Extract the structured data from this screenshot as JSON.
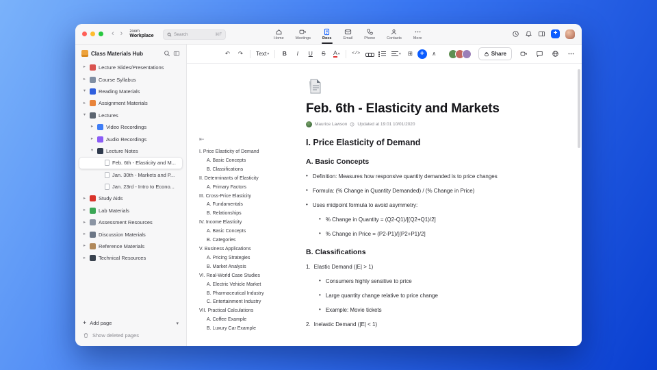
{
  "app": {
    "brand_top": "zoom",
    "brand_bottom": "Workplace",
    "accent_color": "#0b5cff",
    "search": {
      "placeholder": "Search",
      "shortcut": "⌘F"
    },
    "nav": [
      {
        "id": "home",
        "label": "Home",
        "active": false
      },
      {
        "id": "meetings",
        "label": "Meetings",
        "active": false
      },
      {
        "id": "docs",
        "label": "Docs",
        "active": true
      },
      {
        "id": "email",
        "label": "Email",
        "active": false
      },
      {
        "id": "phone",
        "label": "Phone",
        "active": false
      },
      {
        "id": "contacts",
        "label": "Contacts",
        "active": false
      },
      {
        "id": "more",
        "label": "More",
        "active": false
      }
    ]
  },
  "sidebar": {
    "title": "Class Materials Hub",
    "add_page_label": "Add page",
    "show_deleted_label": "Show deleted pages",
    "items": [
      {
        "label": "Lecture Slides/Presentations",
        "depth": 0,
        "chevron": "right",
        "icon": "presentation",
        "color": "#d9534f"
      },
      {
        "label": "Course Syllabus",
        "depth": 0,
        "chevron": "right",
        "icon": "syllabus-document",
        "color": "#7f8ea3"
      },
      {
        "label": "Reading Materials",
        "depth": 0,
        "chevron": "down",
        "icon": "book",
        "color": "#2f5fde"
      },
      {
        "label": "Assignment Materials",
        "depth": 0,
        "chevron": "right",
        "icon": "assignment-pencil",
        "color": "#e8833a"
      },
      {
        "label": "Lectures",
        "depth": 0,
        "chevron": "down",
        "icon": "graduation-cap",
        "color": "#5b6470"
      },
      {
        "label": "Video Recordings",
        "depth": 1,
        "chevron": "right",
        "icon": "video-camera",
        "color": "#3f7df6"
      },
      {
        "label": "Audio Recordings",
        "depth": 1,
        "chevron": "right",
        "icon": "audio-note",
        "color": "#8b5cf6"
      },
      {
        "label": "Lecture Notes",
        "depth": 1,
        "chevron": "down",
        "icon": "notebook",
        "color": "#2f3a4d"
      },
      {
        "label": "Feb. 6th - Elasticity and M...",
        "depth": 2,
        "icon": "page",
        "selected": true
      },
      {
        "label": "Jan. 30th - Markets and P...",
        "depth": 2,
        "icon": "page"
      },
      {
        "label": "Jan. 23rd - Intro to Econo...",
        "depth": 2,
        "icon": "page"
      },
      {
        "label": "Study Aids",
        "depth": 0,
        "chevron": "right",
        "icon": "apple",
        "color": "#d9342b"
      },
      {
        "label": "Lab Materials",
        "depth": 0,
        "chevron": "right",
        "icon": "lab-flask",
        "color": "#3aa655"
      },
      {
        "label": "Assessment Resources",
        "depth": 0,
        "chevron": "right",
        "icon": "assessment-clipboard",
        "color": "#8a94a3"
      },
      {
        "label": "Discussion Materials",
        "depth": 0,
        "chevron": "right",
        "icon": "discussion-bubble",
        "color": "#6b7686"
      },
      {
        "label": "Reference Materials",
        "depth": 0,
        "chevron": "right",
        "icon": "reference-books",
        "color": "#b0885a"
      },
      {
        "label": "Technical Resources",
        "depth": 0,
        "chevron": "right",
        "icon": "technical-wrench",
        "color": "#39424e"
      }
    ]
  },
  "editor_toolbar": {
    "share_label": "Share",
    "collaborator_colors": [
      "#5f8f52",
      "#c4675f",
      "#9b7fb8"
    ],
    "left_items": [
      {
        "name": "undo-icon",
        "glyph": "↶"
      },
      {
        "name": "redo-icon",
        "glyph": "↷"
      },
      {
        "sep": true
      },
      {
        "name": "text-style-dropdown",
        "label": "Text",
        "caret": true
      },
      {
        "sep": true
      },
      {
        "name": "bold-icon",
        "glyph": "B",
        "style": "b"
      },
      {
        "name": "italic-icon",
        "glyph": "I",
        "style": "i"
      },
      {
        "name": "underline-icon",
        "glyph": "U",
        "style": "u"
      },
      {
        "name": "strikethrough-icon",
        "glyph": "S",
        "style": "s"
      },
      {
        "name": "text-color-icon",
        "glyph": "A",
        "style": "a",
        "caret": true
      },
      {
        "sep": true
      },
      {
        "name": "code-icon",
        "glyph": "</>",
        "style": "code"
      },
      {
        "name": "link-icon",
        "css": "link"
      },
      {
        "name": "bulleted-list-icon",
        "css": "list"
      },
      {
        "name": "align-icon",
        "css": "align",
        "caret": true
      },
      {
        "name": "table-icon",
        "glyph": "⊞"
      },
      {
        "name": "insert-plus-button",
        "glyph": "+",
        "style": "insert"
      },
      {
        "name": "collapse-toolbar-icon",
        "glyph": "∧"
      }
    ]
  },
  "toc": {
    "items": [
      {
        "text": "I. Price Elasticity of Demand",
        "level": 0
      },
      {
        "text": "A. Basic Concepts",
        "level": 1
      },
      {
        "text": "B. Classifications",
        "level": 1
      },
      {
        "text": "II. Determinants of Elasticity",
        "level": 0
      },
      {
        "text": "A. Primary Factors",
        "level": 1
      },
      {
        "text": "III. Cross-Price Elasticity",
        "level": 0
      },
      {
        "text": "A. Fundamentals",
        "level": 1
      },
      {
        "text": "B. Relationships",
        "level": 1
      },
      {
        "text": "IV. Income Elasticity",
        "level": 0
      },
      {
        "text": "A. Basic Concepts",
        "level": 1
      },
      {
        "text": "B. Categories",
        "level": 1
      },
      {
        "text": "V. Business Applications",
        "level": 0
      },
      {
        "text": "A. Pricing Strategies",
        "level": 1
      },
      {
        "text": "B. Market Analysis",
        "level": 1
      },
      {
        "text": "VI. Real-World Case Studies",
        "level": 0
      },
      {
        "text": "A. Electric Vehicle Market",
        "level": 1
      },
      {
        "text": "B. Pharmaceutical Industry",
        "level": 1
      },
      {
        "text": "C. Entertainment Industry",
        "level": 1
      },
      {
        "text": "VII. Practical Calculations",
        "level": 0
      },
      {
        "text": "A. Coffee Example",
        "level": 1
      },
      {
        "text": "B. Luxury Car Example",
        "level": 1
      }
    ]
  },
  "doc": {
    "title": "Feb. 6th - Elasticity and Markets",
    "author": "Maurice Lawson",
    "updated_text": "Updated at 19:01 10/01/2020",
    "blocks": [
      {
        "type": "h2",
        "text": "I. Price Elasticity of Demand"
      },
      {
        "type": "h3",
        "text": "A. Basic Concepts"
      },
      {
        "type": "bullet",
        "level": 0,
        "text": "Definition: Measures how responsive quantity demanded is to price changes"
      },
      {
        "type": "bullet",
        "level": 0,
        "text": "Formula: (% Change in Quantity Demanded) / (% Change in Price)"
      },
      {
        "type": "bullet",
        "level": 0,
        "text": "Uses midpoint formula to avoid asymmetry:"
      },
      {
        "type": "bullet",
        "level": 1,
        "text": "% Change in Quantity = (Q2-Q1)/[(Q2+Q1)/2]"
      },
      {
        "type": "bullet",
        "level": 1,
        "text": "% Change in Price = (P2-P1)/[(P2+P1)/2]"
      },
      {
        "type": "h3",
        "text": "B. Classifications"
      },
      {
        "type": "number",
        "num": "1.",
        "text": "Elastic Demand (|E| > 1)"
      },
      {
        "type": "bullet",
        "level": 1,
        "text": "Consumers highly sensitive to price"
      },
      {
        "type": "bullet",
        "level": 1,
        "text": "Large quantity change relative to price change"
      },
      {
        "type": "bullet",
        "level": 1,
        "text": "Example: Movie tickets"
      },
      {
        "type": "number",
        "num": "2.",
        "text": "Inelastic Demand (|E| < 1)"
      }
    ]
  }
}
